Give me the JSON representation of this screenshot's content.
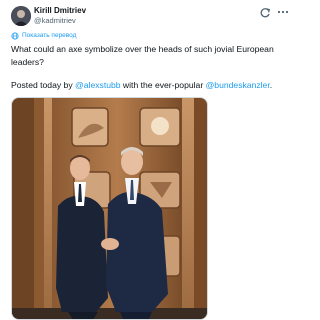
{
  "author": {
    "name": "Kirill Dmitriev",
    "handle": "@kadmitriev"
  },
  "translate": {
    "label": "Показать перевод"
  },
  "post": {
    "line1": "What could an axe symbolize over the heads of such jovial European leaders?",
    "line2_prefix": "Posted today by ",
    "mention1": "@alexstubb",
    "line2_middle": " with the ever-popular ",
    "mention2": "@bundeskanzler",
    "line2_suffix": "."
  },
  "icons": {
    "grok": "grok-icon",
    "more": "more-icon",
    "translate": "globe-icon"
  },
  "colors": {
    "accent": "#1d9bf0",
    "secondary_text": "#536471"
  }
}
